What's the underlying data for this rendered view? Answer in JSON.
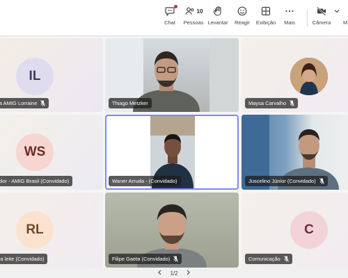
{
  "toolbar": {
    "chat_label": "Chat",
    "people_label": "Pessoas",
    "people_count": "10",
    "raise_label": "Levantar",
    "react_label": "Reagir",
    "view_label": "Exibição",
    "more_label": "Mais",
    "camera_label": "Câmera",
    "mic_label": "M"
  },
  "participants": [
    {
      "name": "sa AMIG Lorraine",
      "initials": "IL",
      "muted": true
    },
    {
      "name": "Thiago Metzker",
      "muted": false
    },
    {
      "name": "Maysa Carvalho",
      "muted": true
    },
    {
      "name": "ador - AMIG Brasil (Convidado)",
      "initials": "WS",
      "muted": false
    },
    {
      "name": "Waner Arruda - (Convidado)",
      "muted": false
    },
    {
      "name": "Juscelino Júnior (Convidado)",
      "muted": true
    },
    {
      "name": "sia leite (Convidado)",
      "initials": "RL",
      "muted": false
    },
    {
      "name": "Filipe Gaeta (Convidado)",
      "muted": true
    },
    {
      "name": "Comunicação",
      "initials": "C",
      "muted": true
    }
  ],
  "pagination": {
    "label": "1/2"
  },
  "colors": {
    "active_outline": "#7f85f5",
    "toolbar_bg": "#ffffff",
    "badge": "#c4314b"
  }
}
